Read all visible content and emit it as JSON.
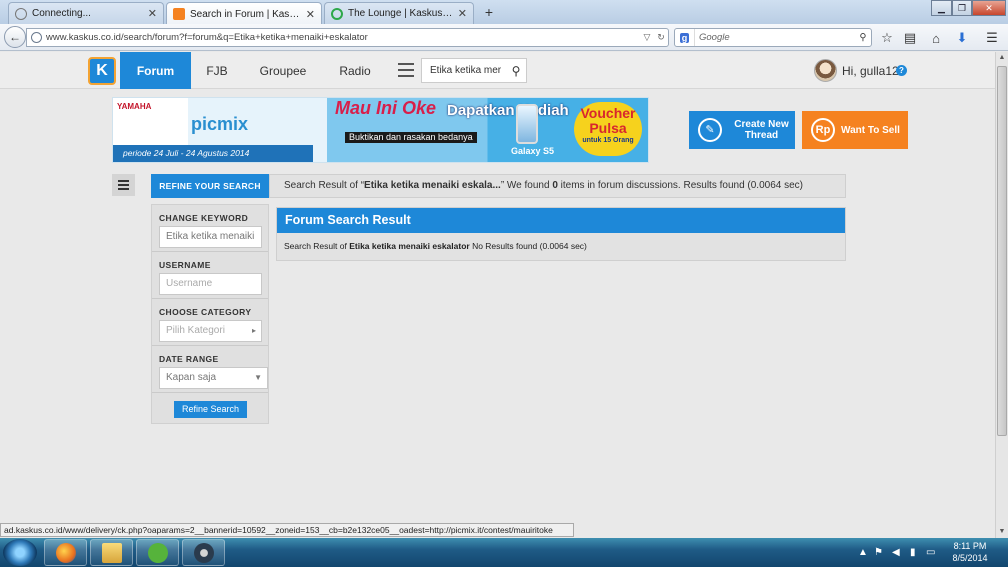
{
  "browser": {
    "tabs": [
      {
        "label": "Connecting...",
        "active": false
      },
      {
        "label": "Search in Forum | Kaskus - ...",
        "active": true
      },
      {
        "label": "The Lounge | Kaskus - The ...",
        "active": false
      }
    ],
    "new_tab": "+",
    "url": "www.kaskus.co.id/search/forum?f=forum&q=Etika+ketika+menaiki+eskalator",
    "search_placeholder": "Google",
    "search_engine_icon": "g"
  },
  "header": {
    "logo": "K",
    "nav": [
      {
        "label": "Forum",
        "active": true
      },
      {
        "label": "FJB",
        "active": false
      },
      {
        "label": "Groupee",
        "active": false
      },
      {
        "label": "Radio",
        "active": false
      }
    ],
    "search_value": "Etika ketika mer",
    "greeting": "Hi, gulla12",
    "help": "?"
  },
  "banner": {
    "brand": "YAMAHA",
    "app": "picmix",
    "period": "periode 24 Juli - 24 Agustus 2014",
    "headline": "Mau Ini Oke",
    "tagline": "Buktikan dan rasakan bedanya",
    "prize": "Dapatkan Hadiah",
    "phone": "Galaxy S5",
    "voucher": "Voucher Pulsa",
    "voucher_note": "untuk 15 Orang"
  },
  "actions": {
    "create_thread": "Create New Thread",
    "want_to_sell": "Want To Sell",
    "rp_icon": "Rp"
  },
  "search": {
    "refine_tab": "REFINE YOUR SEARCH",
    "summary_prefix": "Search Result of “",
    "summary_query": "Etika ketika menaiki eskala...",
    "summary_mid": "” We found ",
    "summary_count": "0",
    "summary_suffix": " items in forum discussions. Results found (0.0064 sec)",
    "sidebar": {
      "keyword_title": "CHANGE KEYWORD",
      "keyword_value": "Etika ketika menaiki",
      "username_title": "USERNAME",
      "username_placeholder": "Username",
      "category_title": "CHOOSE CATEGORY",
      "category_value": "Pilih Kategori",
      "date_title": "DATE RANGE",
      "date_value": "Kapan saja",
      "refine_button": "Refine Search"
    },
    "panel_title": "Forum Search Result",
    "panel_prefix": "Search Result of ",
    "panel_query": "Etika ketika menaiki eskalator",
    "panel_suffix": " No Results found (0.0064 sec)"
  },
  "status_url": "ad.kaskus.co.id/www/delivery/ck.php?oaparams=2__bannerid=10592__zoneid=153__cb=b2e132ce05__oadest=http://picmix.it/contest/mauiritoke",
  "taskbar": {
    "time": "8:11 PM",
    "date": "8/5/2014"
  },
  "colors": {
    "kaskus_blue": "#1e88d8",
    "kaskus_orange": "#f58220",
    "page_bg": "#e9e9e9"
  }
}
